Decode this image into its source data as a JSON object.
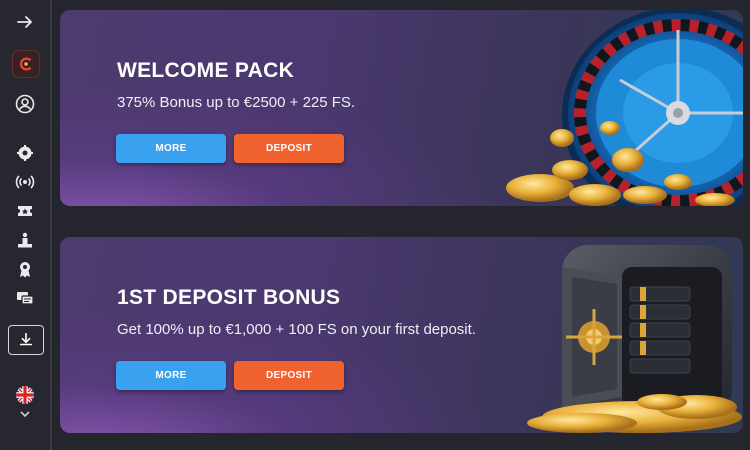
{
  "colors": {
    "more": "#3aa0f0",
    "deposit": "#f0632f",
    "bg": "#24252d"
  },
  "sidebar": {
    "icons": [
      "arrow-right-icon",
      "casino-logo",
      "user-icon",
      "poker-chip-icon",
      "live-broadcast-icon",
      "ticket-icon",
      "podium-icon",
      "award-ribbon-icon",
      "chat-icon",
      "download-icon",
      "uk-flag-icon",
      "chevron-down-icon"
    ]
  },
  "promos": [
    {
      "title": "WELCOME PACK",
      "text": "375% Bonus up to €2500 + 225 FS.",
      "more_label": "MORE",
      "deposit_label": "DEPOSIT",
      "art": "roulette-wheel"
    },
    {
      "title": "1ST DEPOSIT BONUS",
      "text": "Get 100% up to €1,000 + 100 FS on your first deposit.",
      "more_label": "MORE",
      "deposit_label": "DEPOSIT",
      "art": "vault-safe"
    }
  ]
}
